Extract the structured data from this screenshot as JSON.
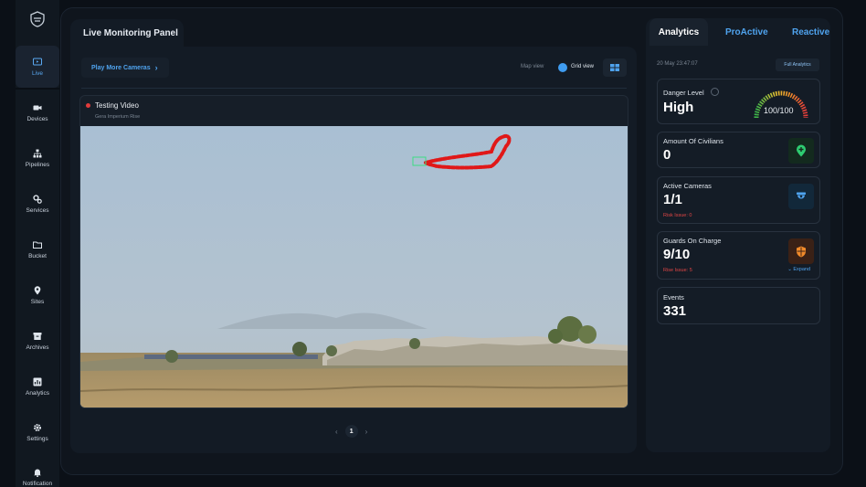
{
  "sidebar": {
    "items": [
      {
        "label": "Live",
        "icon": "tv-icon",
        "active": true
      },
      {
        "label": "Devices",
        "icon": "camera-icon"
      },
      {
        "label": "Pipelines",
        "icon": "pipeline-icon"
      },
      {
        "label": "Services",
        "icon": "gears-icon"
      },
      {
        "label": "Bucket",
        "icon": "folder-icon"
      },
      {
        "label": "Sites",
        "icon": "location-pin-icon"
      },
      {
        "label": "Archives",
        "icon": "archive-icon"
      },
      {
        "label": "Analytics",
        "icon": "chart-icon"
      },
      {
        "label": "Settings",
        "icon": "gear-icon"
      },
      {
        "label": "Notification",
        "icon": "bell-icon"
      }
    ]
  },
  "live": {
    "title": "Live Monitoring Panel",
    "play_more": "Play More Cameras",
    "map_view": "Map view",
    "grid_view": "Grid view",
    "video": {
      "title": "Testing Video",
      "subtitle": "Gera Imperium Rise"
    },
    "page": "1"
  },
  "analytics": {
    "tabs": [
      "Analytics",
      "ProActive",
      "Reactive"
    ],
    "timestamp": "20 May 23:47:07",
    "full_analytics": "Full Analytics",
    "danger": {
      "label": "Danger Level",
      "value": "High",
      "score": "100/100"
    },
    "civilians": {
      "label": "Amount Of Civilians",
      "value": "0"
    },
    "cameras": {
      "label": "Active Cameras",
      "value": "1/1",
      "risk": "Risk Issue: 0"
    },
    "guards": {
      "label": "Guards On Charge",
      "value": "9/10",
      "risk": "Rise Issue: 5",
      "expand": "Expand"
    },
    "events": {
      "label": "Events",
      "value": "331"
    }
  },
  "colors": {
    "accent": "#4fa3ee",
    "risk": "#e04545",
    "track": "#e01818",
    "bbox": "#3ddc84"
  }
}
